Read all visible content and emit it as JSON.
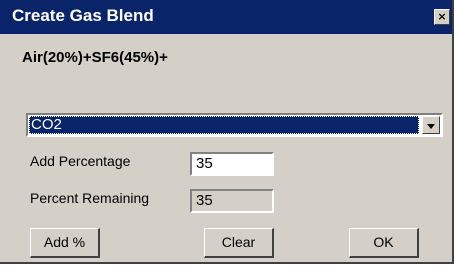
{
  "window": {
    "title": "Create Gas Blend",
    "close_symbol": "×",
    "close_icon": "close-icon"
  },
  "blend": {
    "formula": "Air(20%)+SF6(45%)+"
  },
  "gas_select": {
    "selected": "CO2"
  },
  "add_percentage": {
    "label": "Add Percentage",
    "value": "35"
  },
  "percent_remaining": {
    "label": "Percent Remaining",
    "value": "35"
  },
  "buttons": {
    "add": "Add %",
    "clear": "Clear",
    "ok": "OK"
  },
  "colors": {
    "titlebar": "#0a246a",
    "dialog_face": "#d4d0c8",
    "selection": "#0a246a"
  }
}
